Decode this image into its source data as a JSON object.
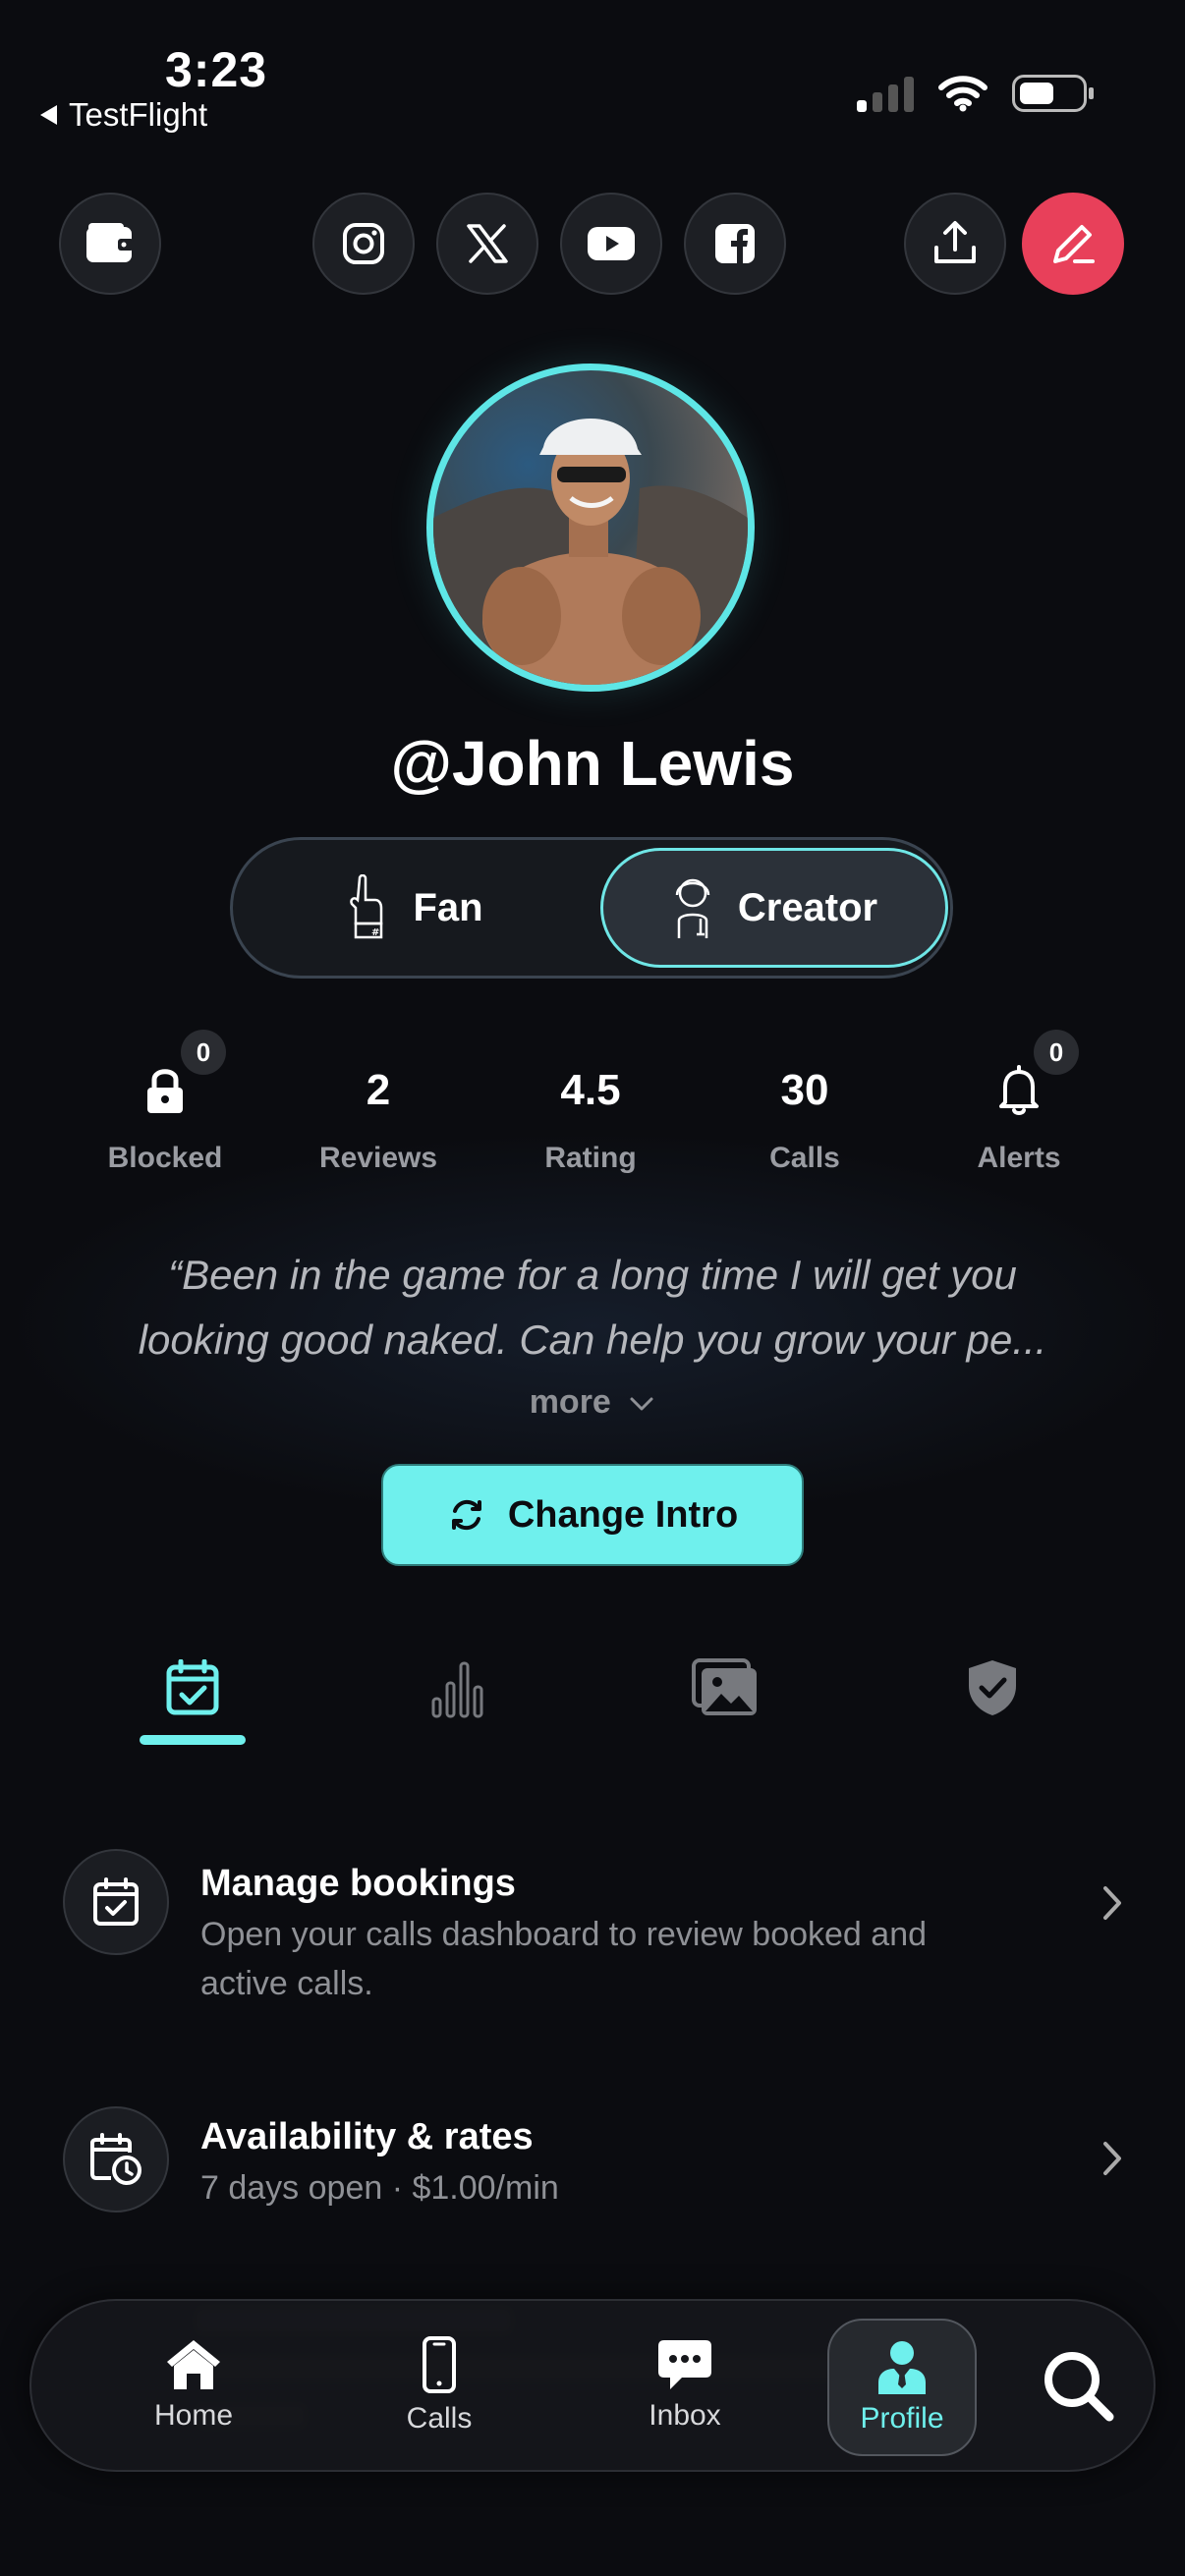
{
  "status_bar": {
    "time": "3:23",
    "back_label": "TestFlight"
  },
  "top_bar": {
    "icons": [
      "wallet-icon",
      "instagram-icon",
      "x-icon",
      "youtube-icon",
      "facebook-icon",
      "share-icon",
      "edit-icon"
    ],
    "edit_color": "#e8405a"
  },
  "profile": {
    "username": "@John Lewis",
    "accent": "#6ff0ed"
  },
  "role_toggle": {
    "options": [
      "Fan",
      "Creator"
    ],
    "selected": "Creator"
  },
  "stats": {
    "blocked": {
      "label": "Blocked",
      "badge": "0"
    },
    "reviews": {
      "value": "2",
      "label": "Reviews"
    },
    "rating": {
      "value": "4.5",
      "label": "Rating"
    },
    "calls": {
      "value": "30",
      "label": "Calls"
    },
    "alerts": {
      "label": "Alerts",
      "badge": "0"
    }
  },
  "bio": {
    "line1": "“Been in the game for a long time I will get you",
    "line2": "looking good naked. Can help you grow your pe...",
    "more_label": "more"
  },
  "change_intro_label": "Change Intro",
  "tabs": {
    "icons": [
      "calendar-check-icon",
      "bar-chart-icon",
      "gallery-icon",
      "shield-check-icon"
    ],
    "active": 0
  },
  "list": {
    "items": [
      {
        "title": "Manage bookings",
        "sub_line1": "Open your calls dashboard to review booked and",
        "sub_line2": "active calls."
      },
      {
        "title": "Availability & rates",
        "sub_line1": "7 days open · $1.00/min"
      }
    ]
  },
  "bottom_nav": {
    "items": [
      {
        "label": "Home"
      },
      {
        "label": "Calls"
      },
      {
        "label": "Inbox"
      },
      {
        "label": "Profile"
      }
    ],
    "active": "Profile"
  }
}
